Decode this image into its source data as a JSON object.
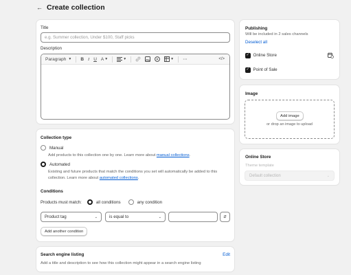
{
  "header": {
    "title": "Create collection"
  },
  "main": {
    "title_label": "Title",
    "title_placeholder": "e.g. Summer collection, Under $100, Staff picks",
    "description_label": "Description",
    "toolbar": {
      "paragraph": "Paragraph"
    }
  },
  "collection_type": {
    "heading": "Collection type",
    "manual": {
      "label": "Manual",
      "help": "Add products to this collection one by one. Learn more about ",
      "link": "manual collections",
      "tail": "."
    },
    "automated": {
      "label": "Automated",
      "help": "Existing and future products that match the conditions you set will automatically be added to this collection. Learn more about ",
      "link": "automated collections",
      "tail": "."
    },
    "conditions_heading": "Conditions",
    "must_match": "Products must match:",
    "all_conditions": "all conditions",
    "any_condition": "any condition",
    "field_select": "Product tag",
    "operator_select": "is equal to",
    "value_input": "",
    "add_condition": "Add another condition"
  },
  "seo": {
    "heading": "Search engine listing",
    "edit": "Edit",
    "description": "Add a title and description to see how this collection might appear in a search engine listing"
  },
  "publishing": {
    "heading": "Publishing",
    "subtext": "Will be included in 2 sales channels",
    "deselect": "Deselect all",
    "channels": [
      "Online Store",
      "Point of Sale"
    ]
  },
  "image": {
    "heading": "Image",
    "add_button": "Add image",
    "drop_text": "or drop an image to upload"
  },
  "online_store": {
    "heading": "Online Store",
    "theme_label": "Theme template",
    "theme_value": "Default collection"
  }
}
